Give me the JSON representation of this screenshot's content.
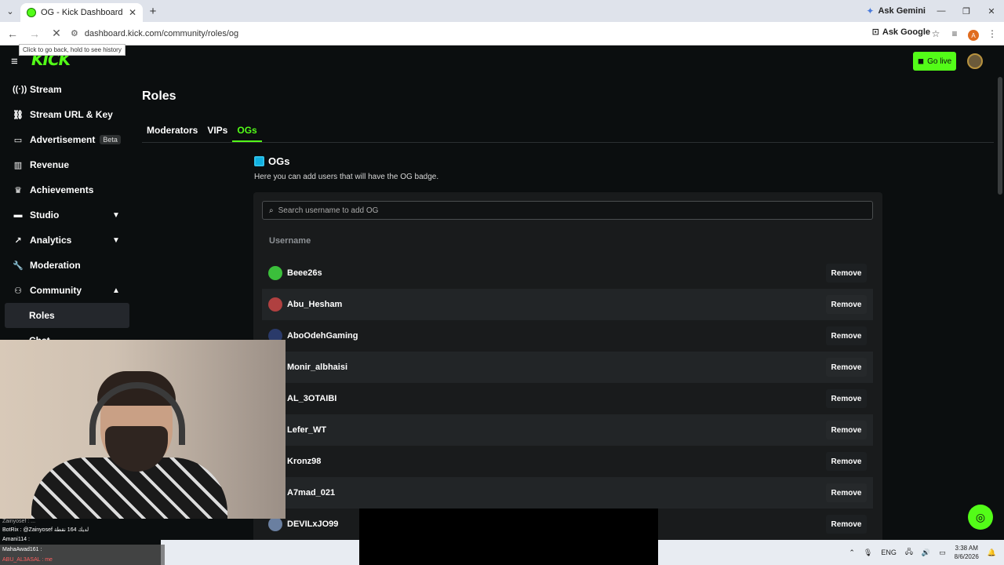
{
  "browser": {
    "tab_title": "OG - Kick Dashboard",
    "new_tab": "+",
    "tab_close": "✕",
    "ask_gemini": "Ask Gemini",
    "url": "dashboard.kick.com/community/roles/og",
    "ask_google": "Ask Google",
    "back_tooltip": "Click to go back, hold to see history",
    "profile_letter": "A"
  },
  "app": {
    "logo": "KICK",
    "go_live": "Go live",
    "accent_color": "#53fc18"
  },
  "sidebar": {
    "items": [
      {
        "label": "Stream",
        "icon": "broadcast-icon"
      },
      {
        "label": "Stream URL & Key",
        "icon": "link-icon"
      },
      {
        "label": "Advertisement",
        "icon": "ad-icon",
        "badge": "Beta"
      },
      {
        "label": "Revenue",
        "icon": "revenue-icon"
      },
      {
        "label": "Achievements",
        "icon": "trophy-icon"
      },
      {
        "label": "Studio",
        "icon": "studio-icon",
        "chevron": "down"
      },
      {
        "label": "Analytics",
        "icon": "analytics-icon",
        "chevron": "down"
      },
      {
        "label": "Moderation",
        "icon": "wrench-icon"
      },
      {
        "label": "Community",
        "icon": "community-icon",
        "chevron": "up"
      }
    ],
    "sub_items": [
      {
        "label": "Roles",
        "active": true
      },
      {
        "label": "Chat",
        "active": false
      }
    ]
  },
  "page": {
    "title": "Roles",
    "tabs": [
      {
        "label": "Moderators",
        "active": false
      },
      {
        "label": "VIPs",
        "active": false
      },
      {
        "label": "OGs",
        "active": true
      }
    ]
  },
  "og_section": {
    "heading": "OGs",
    "description": "Here you can add users that will have the OG badge.",
    "search_placeholder": "Search username to add OG",
    "column_header": "Username",
    "remove_label": "Remove",
    "users": [
      {
        "name": "Beee26s",
        "avatar_color": "#3bbf3b"
      },
      {
        "name": "Abu_Hesham",
        "avatar_color": "#b04040"
      },
      {
        "name": "AboOdehGaming",
        "avatar_color": "#2a3a6a"
      },
      {
        "name": "Monir_albhaisi",
        "avatar_color": "#4a4a4a"
      },
      {
        "name": "AL_3OTAIBI",
        "avatar_color": "#5a5a5a"
      },
      {
        "name": "Lefer_WT",
        "avatar_color": "#3a3a3a"
      },
      {
        "name": "Kronz98",
        "avatar_color": "#444444"
      },
      {
        "name": "A7mad_021",
        "avatar_color": "#505050"
      },
      {
        "name": "DEVILxJO99",
        "avatar_color": "#6a7fa0"
      }
    ]
  },
  "overlay_chat": {
    "lines": [
      {
        "text": "Zainyosef : ..."
      },
      {
        "text": "BotRix : @Zainyosef لديك 164 نقطة"
      },
      {
        "text": "Amani114 :"
      },
      {
        "text": "MahaAwad161 :"
      },
      {
        "text": "ABU_AL3ASAL : me"
      }
    ]
  },
  "taskbar": {
    "language": "ENG",
    "time": "3:38 AM",
    "date": "8/6/2026"
  }
}
